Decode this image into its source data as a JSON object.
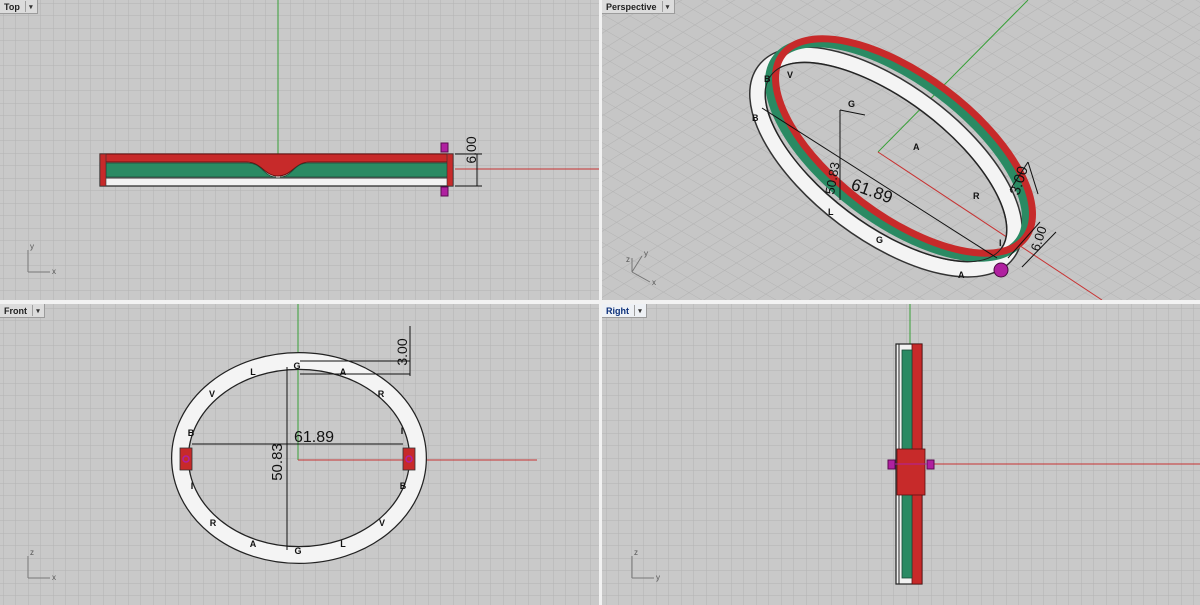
{
  "viewports": {
    "top": {
      "label": "Top",
      "dim_height": "6.00",
      "axis_x": "x",
      "axis_y": "y"
    },
    "perspective": {
      "label": "Perspective",
      "dim_width": "61.89",
      "dim_height": "50.83",
      "dim_thickness": "3.00",
      "dim_depth": "6.00",
      "axis_x": "x",
      "axis_y": "y",
      "axis_z": "z"
    },
    "front": {
      "label": "Front",
      "dim_width": "61.89",
      "dim_height": "50.83",
      "dim_thickness": "3.00",
      "axis_x": "x",
      "axis_z": "z"
    },
    "right": {
      "label": "Right",
      "axis_y": "y",
      "axis_z": "z"
    }
  },
  "dropdown_glyph": "▾",
  "ring_letters": [
    "B",
    "V",
    "L",
    "G",
    "A",
    "R",
    "I",
    "B",
    "V",
    "L",
    "G",
    "A",
    "R",
    "I"
  ],
  "colors": {
    "viewport_bg": "#c9c9c9",
    "grid_line": "#b4b4b4",
    "grid_major": "#a6a6a6",
    "x_axis": "#c83232",
    "y_axis": "#37a037",
    "band_red": "#c72a2a",
    "band_green": "#2a8a63",
    "band_white": "#f4f4f4",
    "pin_magenta": "#b020a0",
    "active_label": "#0a2f7a"
  }
}
